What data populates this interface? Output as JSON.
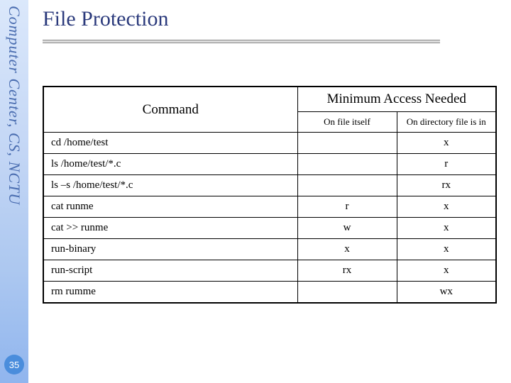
{
  "side_label": "Computer Center, CS, NCTU",
  "title": "File Protection",
  "page_number": "35",
  "table": {
    "command_header": "Command",
    "access_header": "Minimum Access Needed",
    "sub_headers": {
      "on_file": "On file itself",
      "on_dir": "On directory file is in"
    },
    "rows": [
      {
        "cmd": "cd /home/test",
        "on_file": "",
        "on_dir": "x"
      },
      {
        "cmd": "ls /home/test/*.c",
        "on_file": "",
        "on_dir": "r"
      },
      {
        "cmd": "ls –s /home/test/*.c",
        "on_file": "",
        "on_dir": "rx"
      },
      {
        "cmd": "cat runme",
        "on_file": "r",
        "on_dir": "x"
      },
      {
        "cmd": "cat >> runme",
        "on_file": "w",
        "on_dir": "x"
      },
      {
        "cmd": "run-binary",
        "on_file": "x",
        "on_dir": "x"
      },
      {
        "cmd": "run-script",
        "on_file": "rx",
        "on_dir": "x"
      },
      {
        "cmd": "rm rumme",
        "on_file": "",
        "on_dir": "wx"
      }
    ]
  },
  "chart_data": {
    "type": "table",
    "title": "File Protection",
    "columns": [
      "Command",
      "On file itself",
      "On directory file is in"
    ],
    "rows": [
      [
        "cd /home/test",
        "",
        "x"
      ],
      [
        "ls /home/test/*.c",
        "",
        "r"
      ],
      [
        "ls –s /home/test/*.c",
        "",
        "rx"
      ],
      [
        "cat runme",
        "r",
        "x"
      ],
      [
        "cat >> runme",
        "w",
        "x"
      ],
      [
        "run-binary",
        "x",
        "x"
      ],
      [
        "run-script",
        "rx",
        "x"
      ],
      [
        "rm rumme",
        "",
        "wx"
      ]
    ]
  }
}
